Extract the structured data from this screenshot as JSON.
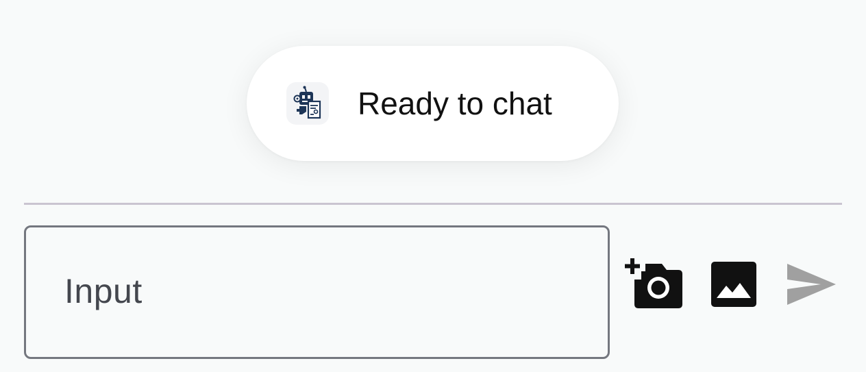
{
  "status": {
    "text": "Ready to chat",
    "icon": "robot-icon"
  },
  "composer": {
    "placeholder": "Input",
    "icons": {
      "camera": "add-a-photo-icon",
      "image": "image-icon",
      "send": "send-icon"
    }
  },
  "colors": {
    "background": "#f8fafa",
    "text": "#111111",
    "divider": "#cac4d0",
    "outline": "#74777f",
    "icon": "#111111",
    "send_disabled": "#a0a0a0",
    "avatar_navy": "#1d3557"
  }
}
